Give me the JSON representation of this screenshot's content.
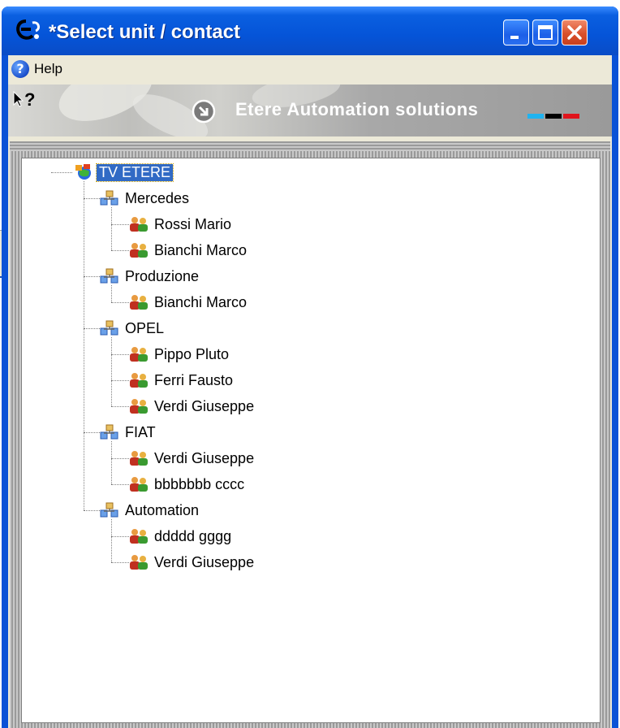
{
  "window": {
    "title": "*Select unit / contact"
  },
  "menu": {
    "help_label": "Help",
    "help_icon": "?"
  },
  "banner": {
    "cursor_glyph": "?",
    "text": "Etere Automation solutions",
    "flag_colors": [
      "#1fb3f0",
      "#000000",
      "#e0141c"
    ]
  },
  "tree": {
    "root": {
      "label": "TV ETERE",
      "icon": "globe-network-icon",
      "selected": true
    },
    "units": [
      {
        "label": "Mercedes",
        "icon": "unit-network-icon",
        "contacts": [
          "Rossi Mario",
          "Bianchi Marco"
        ]
      },
      {
        "label": "Produzione",
        "icon": "unit-network-icon",
        "contacts": [
          "Bianchi Marco"
        ]
      },
      {
        "label": "OPEL",
        "icon": "unit-network-icon",
        "contacts": [
          "Pippo Pluto",
          "Ferri Fausto",
          "Verdi Giuseppe"
        ]
      },
      {
        "label": "FIAT",
        "icon": "unit-network-icon",
        "contacts": [
          "Verdi Giuseppe",
          "bbbbbbb cccc"
        ]
      },
      {
        "label": "Automation",
        "icon": "unit-network-icon",
        "contacts": [
          "ddddd gggg",
          "Verdi Giuseppe"
        ]
      }
    ]
  }
}
